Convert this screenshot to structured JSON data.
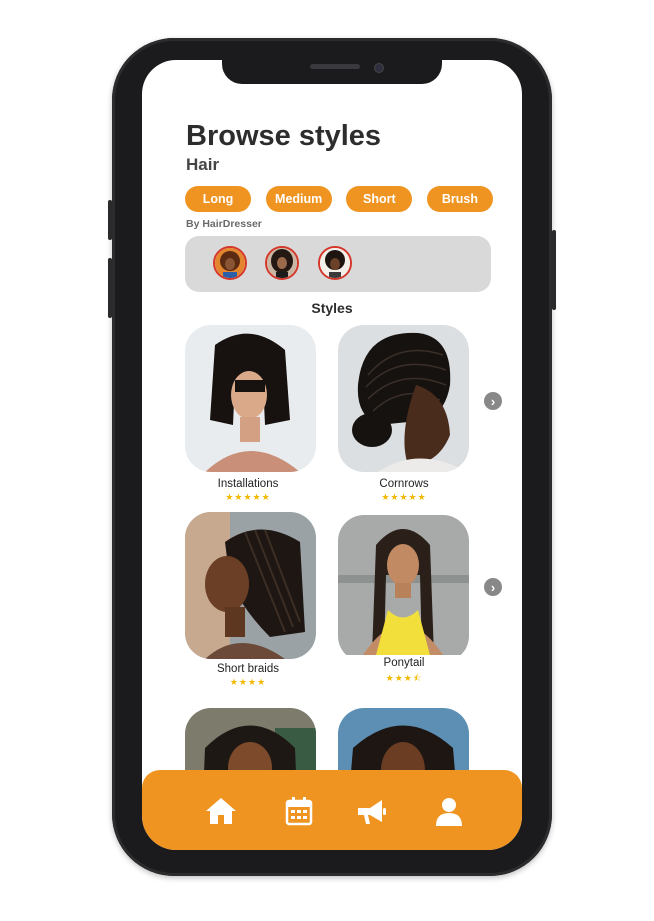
{
  "header": {
    "title": "Browse styles",
    "subtitle": "Hair"
  },
  "chips": [
    {
      "label": "Long"
    },
    {
      "label": "Medium"
    },
    {
      "label": "Short"
    },
    {
      "label": "Brush"
    }
  ],
  "dressers": {
    "heading": "By HairDresser",
    "count": 3
  },
  "styles": {
    "heading": "Styles",
    "items": [
      {
        "name": "Installations",
        "stars": "★★★★★",
        "rating": 5
      },
      {
        "name": "Cornrows",
        "stars": "★★★★★",
        "rating": 5
      },
      {
        "name": "Short braids",
        "stars": "★★★★",
        "rating": 4
      },
      {
        "name": "Ponytail",
        "stars": "★★★⯪",
        "rating": 3.5
      },
      {
        "name": "",
        "stars": ""
      },
      {
        "name": "",
        "stars": ""
      }
    ]
  },
  "nav": [
    "home-icon",
    "calendar-icon",
    "megaphone-icon",
    "profile-icon"
  ],
  "colors": {
    "accent": "#ef9421",
    "star": "#f3b900",
    "panel": "#d9d9da",
    "avatar_ring": "#d5372b"
  }
}
